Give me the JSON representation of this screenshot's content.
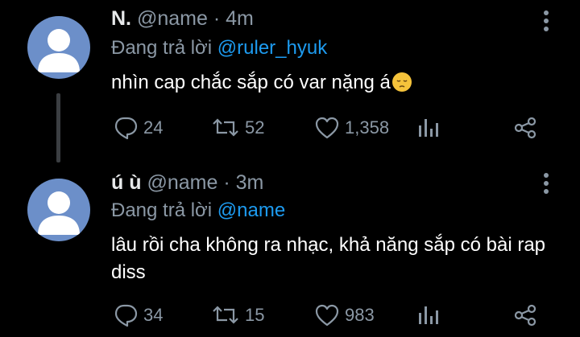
{
  "tweets": [
    {
      "display_name": "N.",
      "handle": "@name",
      "separator": "·",
      "time": "4m",
      "reply_prefix": "Đang trả lời",
      "reply_to": "@ruler_hyuk",
      "text": "nhìn cap chắc sắp có var nặng á",
      "emoji": "pensive-face",
      "replies": "24",
      "retweets": "52",
      "likes": "1,358"
    },
    {
      "display_name": "ú ù",
      "handle": "@name",
      "separator": "·",
      "time": "3m",
      "reply_prefix": "Đang trả lời",
      "reply_to": "@name",
      "text": "lâu rồi cha không ra nhạc, khả năng sắp có bài rap diss",
      "replies": "34",
      "retweets": "15",
      "likes": "983"
    }
  ],
  "colors": {
    "background": "#000000",
    "primary_text": "#e7e9ea",
    "secondary_text": "#8b98a5",
    "mention": "#1d9bf0",
    "avatar_bg": "#6c8fc9"
  },
  "icons": [
    "reply-icon",
    "retweet-icon",
    "like-icon",
    "analytics-icon",
    "share-icon",
    "more-options-icon",
    "default-avatar-icon"
  ]
}
